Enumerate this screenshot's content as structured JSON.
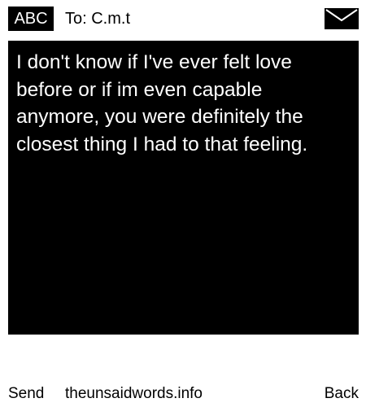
{
  "header": {
    "mode_label": "ABC",
    "recipient": "To: C.m.t",
    "icon": "envelope-icon"
  },
  "message": {
    "text": "I don't know if I've ever felt love before or if im even capable anymore, you were definitely the closest thing I had to that feeling."
  },
  "footer": {
    "send_label": "Send",
    "site_label": "theunsaidwords.info",
    "back_label": "Back"
  },
  "colors": {
    "background": "#ffffff",
    "message_background": "#000000",
    "message_text": "#ffffff"
  }
}
